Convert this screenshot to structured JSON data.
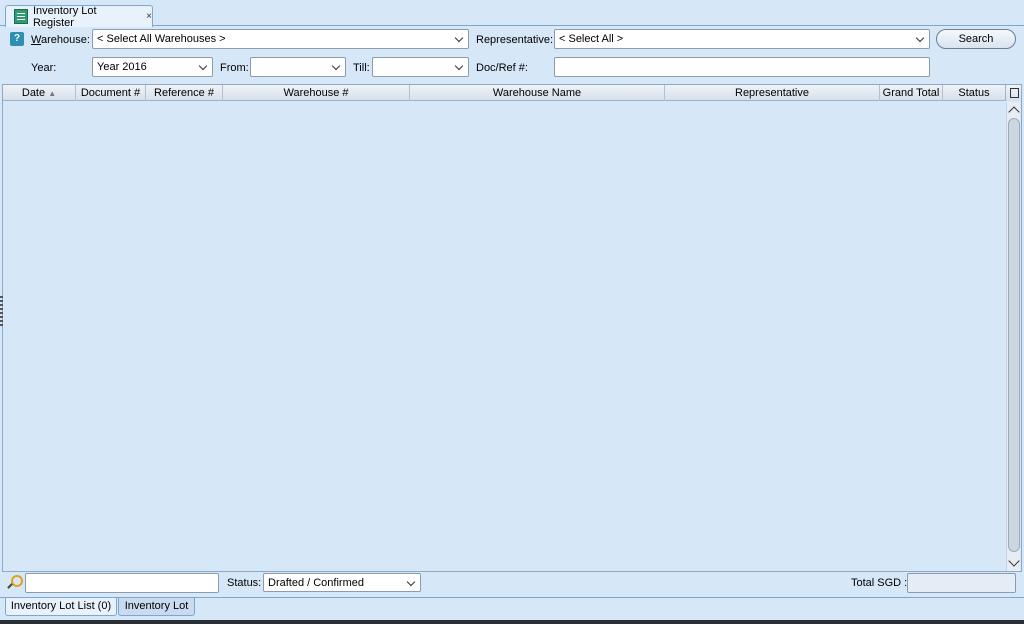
{
  "document_tab": {
    "title": "Inventory Lot Register",
    "close": "×"
  },
  "help_icon": "?",
  "filters": {
    "warehouse_label": "Warehouse:",
    "warehouse_value": "< Select All Warehouses >",
    "representative_label": "Representative:",
    "representative_value": "< Select All >",
    "search_button": "Search",
    "year_label": "Year:",
    "year_value": "Year 2016",
    "from_label": "From:",
    "from_value": "",
    "till_label": "Till:",
    "till_value": "",
    "docref_label": "Doc/Ref #:",
    "docref_value": ""
  },
  "grid": {
    "columns": [
      {
        "label": "Date",
        "sort_indicator": "▲"
      },
      {
        "label": "Document #"
      },
      {
        "label": "Reference #"
      },
      {
        "label": "Warehouse #"
      },
      {
        "label": "Warehouse Name"
      },
      {
        "label": "Representative"
      },
      {
        "label": "Grand Total"
      },
      {
        "label": "Status"
      }
    ],
    "rows": []
  },
  "footer": {
    "find_value": "",
    "status_label": "Status:",
    "status_value": "Drafted / Confirmed",
    "total_label": "Total SGD :",
    "total_value": ""
  },
  "bottom_tabs": [
    {
      "label": "Inventory Lot List (0)",
      "active": true
    },
    {
      "label": "Inventory Lot",
      "active": false
    }
  ]
}
